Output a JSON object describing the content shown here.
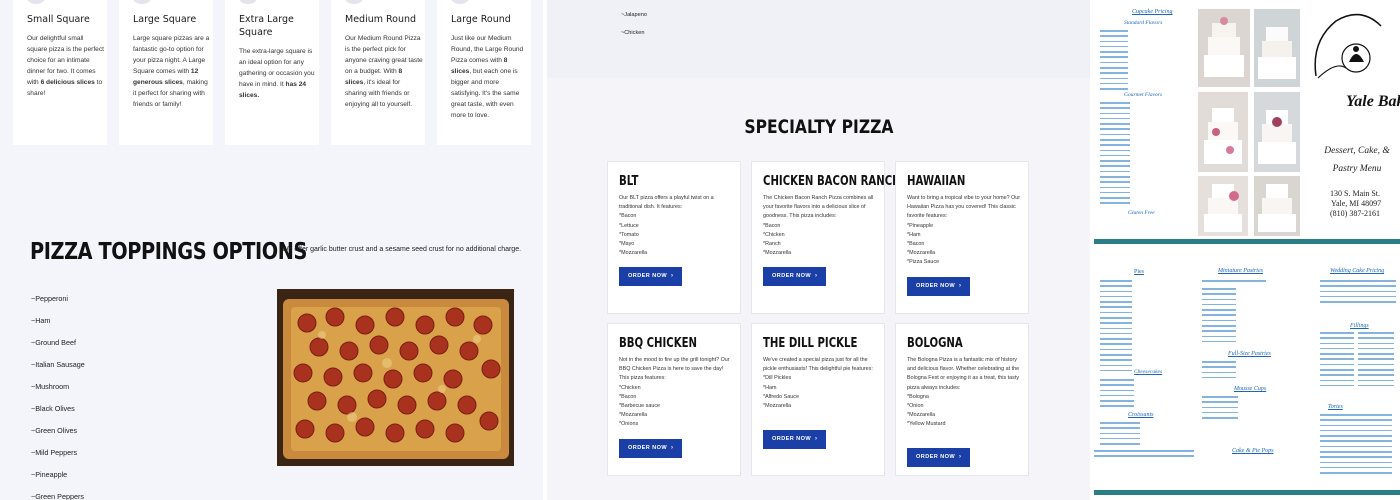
{
  "sizes": [
    {
      "title": "Small Square",
      "desc_pre": "Our delightful small square pizza is the perfect choice for an intimate dinner for two. It comes with ",
      "desc_bold": "6 delicious slices",
      "desc_post": " to share!"
    },
    {
      "title": "Large Square",
      "desc_pre": "Large square pizzas are a fantastic go-to option for your pizza night. A Large Square comes with ",
      "desc_bold": "12 generous slices",
      "desc_post": ", making it perfect for sharing with friends or family!"
    },
    {
      "title": "Extra Large Square",
      "desc_pre": "The extra-large square is an ideal option for any gathering or occasion you have in mind. It ",
      "desc_bold": "has 24 slices.",
      "desc_post": ""
    },
    {
      "title": "Medium Round",
      "desc_pre": "Our Medium Round Pizza is the perfect pick for anyone craving great taste on a budget. With ",
      "desc_bold": "8 slices",
      "desc_post": ", it's ideal for sharing with friends or enjoying all to yourself."
    },
    {
      "title": "Large Round",
      "desc_pre": "Just like our Medium Round, the Large Round Pizza comes with ",
      "desc_bold": "8 slices",
      "desc_post": ", but each one is bigger and more satisfying. It's the same great taste, with even more to love."
    }
  ],
  "toppings": {
    "title": "PIZZA TOPPINGS OPTIONS",
    "crust_note": "We offer garlic butter crust and a sesame seed crust for no additional charge.",
    "items": [
      "~Pepperoni",
      "~Ham",
      "~Ground Beef",
      "~Italian Sausage",
      "~Mushroom",
      "~Black Olives",
      "~Green Olives",
      "~Mild Peppers",
      "~Pineapple",
      "~Green Peppers"
    ]
  },
  "middle_top_items": [
    "~Jalapeno",
    "~Chicken"
  ],
  "specialty": {
    "title": "SPECIALTY PIZZA",
    "order_label": "ORDER NOW",
    "cards": [
      {
        "name": "BLT",
        "desc": "Our BLT pizza offers a playful twist on a traditional dish. It features:\n*Bacon\n*Lettuce\n*Tomato\n*Mayo\n*Mozzarella"
      },
      {
        "name": "CHICKEN BACON RANCH",
        "desc": "The Chicken Bacon Ranch Pizza combines all your favorite flavors into a delicious slice of goodness. This pizza includes:\n*Bacon\n*Chicken\n*Ranch\n*Mozzarella"
      },
      {
        "name": "HAWAIIAN",
        "desc": "Want to bring a tropical vibe to your home? Our Hawaiian Pizza has you covered! This classic favorite features:\n*Pineapple\n*Ham\n*Bacon\n*Mozzarella\n*Pizza Sauce"
      },
      {
        "name": "BBQ CHICKEN",
        "desc": "Not in the mood to fire up the grill tonight? Our BBQ Chicken Pizza is here to save the day! This pizza features:\n*Chicken\n*Bacon\n*Barbecue sauce\n*Mozzarella\n*Onions"
      },
      {
        "name": "THE DILL PICKLE",
        "desc": "We've created a special pizza just for all the pickle enthusiasts! This delightful pie features:\n*Dill Pickles\n*Ham\n*Alfredo Sauce\n*Mozzarella"
      },
      {
        "name": "BOLOGNA",
        "desc": "The Bologna Pizza is a fantastic mix of history and delicious flavor. Whether celebrating at the Bologna Fest or enjoying it as a treat, this tasty pizza always includes:\n*Bologna\n*Onion\n*Mozzarella\n*Yellow Mustard"
      }
    ]
  },
  "bakery": {
    "name": "Yale Bakery",
    "subtitle": "Dessert, Cake, & Pastry Menu",
    "address_1": "130 S. Main St.",
    "address_2": "Yale, MI 48097",
    "phone": "(810) 387-2161",
    "cupcake_heading": "Cupcake Pricing",
    "standard_flavors": "Standard Flavors",
    "gourmet_flavors": "Gourmet Flavors",
    "gluten_free": "Gluten Free",
    "pies": "Pies",
    "mini_pastries": "Miniature Pastries",
    "wedding_pricing": "Wedding Cake Pricing",
    "full_size": "Full-Size Pastries",
    "cheesecakes": "Cheesecakes",
    "croissants": "Croissants",
    "mousse_cups": "Mousse Cups",
    "tortes": "Tortes",
    "fillings": "Fillings",
    "cake_pie_pops": "Cake & Pie Pops"
  },
  "colors": {
    "order_button": "#1a40a8",
    "flyer_border": "#2a7f86",
    "flyer_text": "#1a66b8"
  }
}
